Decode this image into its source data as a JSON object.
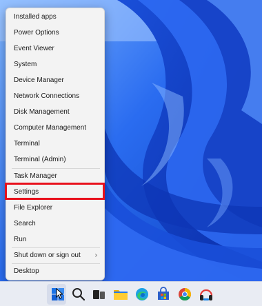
{
  "menu": {
    "items": [
      {
        "label": "Installed apps"
      },
      {
        "label": "Power Options"
      },
      {
        "label": "Event Viewer"
      },
      {
        "label": "System"
      },
      {
        "label": "Device Manager"
      },
      {
        "label": "Network Connections"
      },
      {
        "label": "Disk Management"
      },
      {
        "label": "Computer Management"
      },
      {
        "label": "Terminal"
      },
      {
        "label": "Terminal (Admin)"
      },
      {
        "label": "Task Manager"
      },
      {
        "label": "Settings",
        "highlighted": true
      },
      {
        "label": "File Explorer"
      },
      {
        "label": "Search"
      },
      {
        "label": "Run"
      },
      {
        "label": "Shut down or sign out",
        "has_submenu": true
      },
      {
        "label": "Desktop"
      }
    ],
    "highlight_color": "#e8101c"
  },
  "taskbar": {
    "icons": [
      "start-icon",
      "search-icon",
      "task-view-icon",
      "file-explorer-icon",
      "edge-icon",
      "store-icon",
      "chrome-icon",
      "headphones-app-icon"
    ]
  },
  "colors": {
    "wallpaper_blue": "#1c57d8",
    "taskbar_bg": "#e9ecf3"
  }
}
